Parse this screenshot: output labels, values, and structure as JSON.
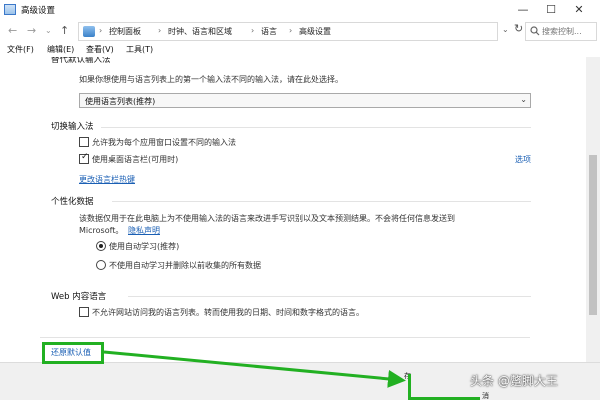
{
  "window": {
    "title": "高级设置",
    "icon": "control-panel-icon",
    "controls": {
      "minimize": "—",
      "maximize": "☐",
      "close": "✕"
    }
  },
  "addressbar": {
    "crumbs": [
      "控制面板",
      "时钟、语言和区域",
      "语言",
      "高级设置"
    ],
    "search_placeholder": "搜索控制..."
  },
  "menu": [
    "文件(F)",
    "编辑(E)",
    "查看(V)",
    "工具(T)"
  ],
  "content": {
    "override_default_input": {
      "heading": "替代默认输入法",
      "description": "如果你想使用与语言列表上的第一个输入法不同的输入法，请在此处选择。",
      "dropdown_value": "使用语言列表(推荐)"
    },
    "switch_input": {
      "heading": "切换输入法",
      "option_per_app": {
        "label": "允许我为每个应用窗口设置不同的输入法",
        "checked": false
      },
      "option_language_bar": {
        "label": "使用桌面语言栏(可用时)",
        "checked": true
      },
      "options_link": "选项",
      "hotkey_link": "更改语言栏热键"
    },
    "personalization": {
      "heading": "个性化数据",
      "description_line1": "该数据仅用于在此电脑上为不使用输入法的语言来改进手写识别以及文本预测结果。不会将任何信息发送到",
      "description_line2": "Microsoft。",
      "privacy_link": "隐私声明",
      "radio_auto_learn": {
        "label": "使用自动学习(推荐)",
        "selected": true
      },
      "radio_no_auto_learn": {
        "label": "不使用自动学习并删除以前收集的所有数据",
        "selected": false
      }
    },
    "web_content_language": {
      "heading": "Web 内容语言",
      "option_block": {
        "label": "不允许网站访问我的语言列表。转而使用我的日期、时间和数字格式的语言。",
        "checked": false
      }
    },
    "restore_defaults_link": "还原默认值"
  },
  "bottombar": {
    "save_fragment": "存",
    "cancel_fragment": "消"
  },
  "annotation": {
    "color": "#22b022",
    "watermark": "头条 @蹩脚大王"
  }
}
